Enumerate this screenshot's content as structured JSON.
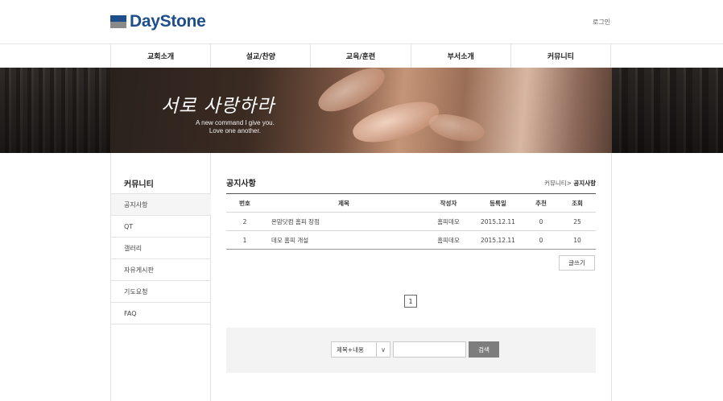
{
  "header": {
    "logo_text": "DayStone",
    "login_label": "로그인"
  },
  "nav": {
    "items": [
      "교회소개",
      "설교/찬양",
      "교육/훈련",
      "부서소개",
      "커뮤니티"
    ]
  },
  "banner": {
    "slogan": "서로 사랑하라",
    "sub_line1": "A new command I give you.",
    "sub_line2": "Love one another."
  },
  "sidebar": {
    "title": "커뮤니티",
    "items": [
      "공지사항",
      "QT",
      "갤러리",
      "자유게시판",
      "기도요청",
      "FAQ"
    ]
  },
  "content": {
    "title": "공지사항",
    "breadcrumb_parent": "커뮤니티>",
    "breadcrumb_current": "공지사항"
  },
  "board": {
    "columns": [
      "번호",
      "제목",
      "작성자",
      "등록일",
      "추천",
      "조회"
    ],
    "rows": [
      {
        "no": "2",
        "subject": "온맘닷컴 홈피 장점",
        "writer": "홈피데모",
        "date": "2015.12.11",
        "recommend": "0",
        "views": "25"
      },
      {
        "no": "1",
        "subject": "데모 홈피 개설",
        "writer": "홈피데모",
        "date": "2015.12.11",
        "recommend": "0",
        "views": "10"
      }
    ]
  },
  "write_label": "글쓰기",
  "pagination": {
    "current": "1"
  },
  "search": {
    "select_value": "제목+내용",
    "input_value": "",
    "button_label": "검색"
  },
  "colors": {
    "brand": "#1f4e8c",
    "search_button": "#7d7d7d"
  }
}
